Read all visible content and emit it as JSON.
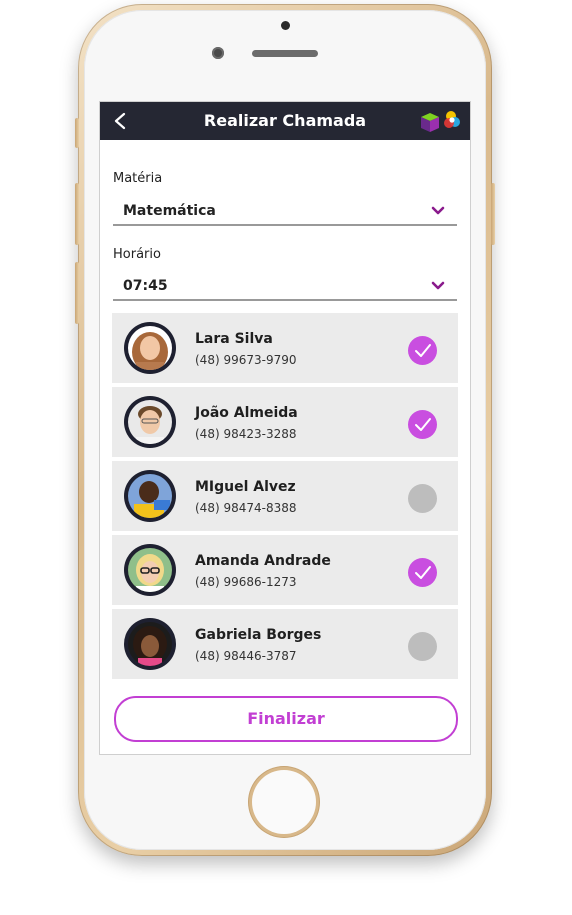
{
  "header": {
    "title": "Realizar Chamada",
    "back_icon": "chevron-left-icon",
    "logo_icon": "cube-logo-icon"
  },
  "form": {
    "subject": {
      "label": "Matéria",
      "value": "Matemática"
    },
    "time": {
      "label": "Horário",
      "value": "07:45"
    }
  },
  "students": [
    {
      "name": "Lara Silva",
      "phone": "(48) 99673-9790",
      "present": true
    },
    {
      "name": "João Almeida",
      "phone": "(48) 98423-3288",
      "present": true
    },
    {
      "name": "MIguel Alvez",
      "phone": "(48) 98474-8388",
      "present": false
    },
    {
      "name": "Amanda Andrade",
      "phone": "(48) 99686-1273",
      "present": true
    },
    {
      "name": "Gabriela Borges",
      "phone": "(48) 98446-3787",
      "present": false
    }
  ],
  "footer": {
    "finish_label": "Finalizar"
  },
  "colors": {
    "header_bg": "#252733",
    "accent": "#c94ee0",
    "chevron": "#8a1a8c",
    "row_bg": "#ebebeb",
    "unchecked": "#bdbdbd"
  }
}
